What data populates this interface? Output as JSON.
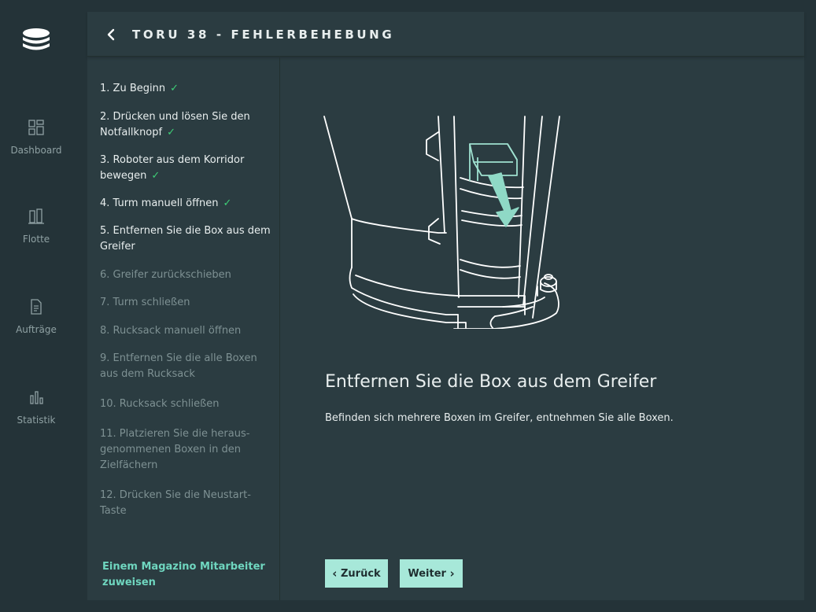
{
  "nav": {
    "items": [
      {
        "label": "Dashboard",
        "icon": "dashboard-icon"
      },
      {
        "label": "Flotte",
        "icon": "fleet-icon"
      },
      {
        "label": "Aufträge",
        "icon": "orders-icon"
      },
      {
        "label": "Statistik",
        "icon": "statistics-icon"
      }
    ]
  },
  "header": {
    "title": "TORU 38 - FEHLERBEHEBUNG"
  },
  "steps": [
    {
      "label": "1. Zu Beginn",
      "done": true
    },
    {
      "label": "2. Drücken und lösen Sie den Notfallknopf",
      "done": true
    },
    {
      "label": "3. Roboter aus dem Korridor bewegen",
      "done": true
    },
    {
      "label": "4. Turm manuell öffnen",
      "done": true
    },
    {
      "label": "5. Entfernen Sie die Box aus dem Greifer",
      "done": false,
      "current": true
    },
    {
      "label": "6. Greifer zurückschieben",
      "done": false
    },
    {
      "label": "7. Turm schließen",
      "done": false
    },
    {
      "label": "8. Rucksack manuell öffnen",
      "done": false
    },
    {
      "label": "9. Entfernen Sie die alle Boxen aus dem Rucksack",
      "done": false
    },
    {
      "label": "10. Rucksack schließen",
      "done": false
    },
    {
      "label": "11. Platzieren Sie die heraus-genommenen Boxen in den Zielfächern",
      "done": false
    },
    {
      "label": "12. Drücken Sie die Neustart-Taste",
      "done": false
    }
  ],
  "assign_link": "Einem Magazino Mitarbeiter zuweisen",
  "content": {
    "title": "Entfernen Sie die Box aus dem Greifer",
    "description": "Befinden sich mehrere Boxen im Greifer, entnehmen Sie alle Boxen."
  },
  "buttons": {
    "back_label": "Zurück",
    "next_label": "Weiter"
  },
  "colors": {
    "background": "#243338",
    "panel": "#2b3c41",
    "accent": "#a7e8d9",
    "check": "#3ecf77",
    "link": "#6fd6bf"
  }
}
